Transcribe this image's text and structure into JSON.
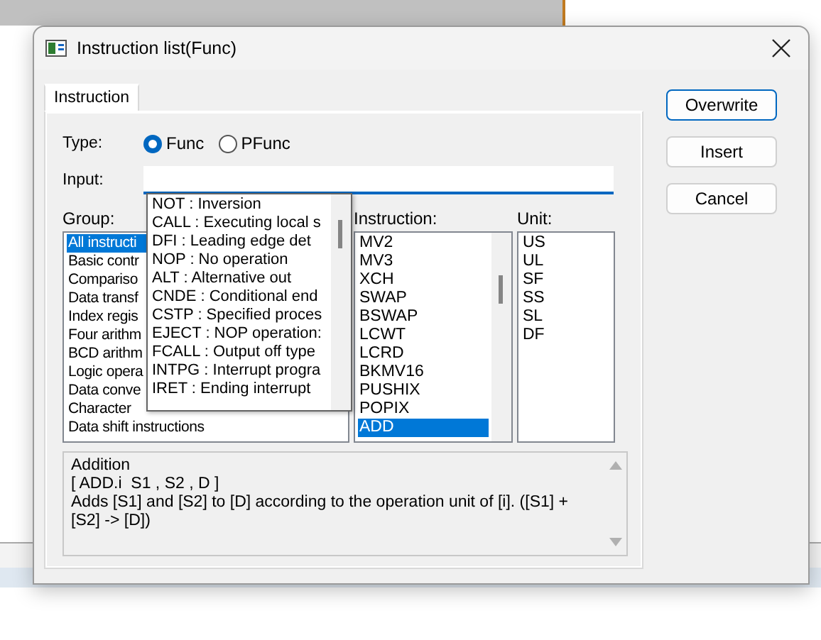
{
  "dialog": {
    "title": "Instruction list(Func)"
  },
  "tabs": [
    {
      "label": "Instruction",
      "selected": true
    }
  ],
  "type": {
    "label": "Type:",
    "options": [
      {
        "label": "Func",
        "selected": true
      },
      {
        "label": "PFunc",
        "selected": false
      }
    ]
  },
  "input": {
    "label": "Input:"
  },
  "dropdown": {
    "items": [
      {
        "text": "NOT : Inversion",
        "selected": false
      },
      {
        "text": "CALL : Executing local s",
        "selected": false
      },
      {
        "text": "DFI : Leading edge det",
        "selected": false
      },
      {
        "text": "NOP : No operation",
        "selected": false
      },
      {
        "text": "ALT : Alternative out",
        "selected": false
      },
      {
        "text": "CNDE : Conditional end",
        "selected": false
      },
      {
        "text": "CSTP : Specified proces",
        "selected": false
      },
      {
        "text": "EJECT : NOP operation:",
        "selected": false
      },
      {
        "text": "FCALL : Output off type",
        "selected": false
      },
      {
        "text": "INTPG : Interrupt progra",
        "selected": false
      },
      {
        "text": "IRET : Ending interrupt",
        "selected": false
      }
    ]
  },
  "group": {
    "label": "Group:",
    "items": [
      {
        "text": "All instructi",
        "selected": true
      },
      {
        "text": "Basic contr",
        "selected": false
      },
      {
        "text": "Compariso",
        "selected": false
      },
      {
        "text": "Data transf",
        "selected": false
      },
      {
        "text": "Index regis",
        "selected": false
      },
      {
        "text": "Four arithm",
        "selected": false
      },
      {
        "text": "BCD arithm",
        "selected": false
      },
      {
        "text": "Logic opera",
        "selected": false
      },
      {
        "text": "Data conve",
        "selected": false
      },
      {
        "text": "Character",
        "selected": false
      },
      {
        "text": "Data shift instructions",
        "selected": false
      }
    ]
  },
  "instruction": {
    "label": "Instruction:",
    "items": [
      {
        "text": "MV2",
        "selected": false
      },
      {
        "text": "MV3",
        "selected": false
      },
      {
        "text": "XCH",
        "selected": false
      },
      {
        "text": "SWAP",
        "selected": false
      },
      {
        "text": "BSWAP",
        "selected": false
      },
      {
        "text": "LCWT",
        "selected": false
      },
      {
        "text": "LCRD",
        "selected": false
      },
      {
        "text": "BKMV16",
        "selected": false
      },
      {
        "text": "PUSHIX",
        "selected": false
      },
      {
        "text": "POPIX",
        "selected": false
      },
      {
        "text": "ADD",
        "selected": true
      }
    ]
  },
  "unit": {
    "label": "Unit:",
    "items": [
      {
        "text": "US",
        "selected": false
      },
      {
        "text": "UL",
        "selected": false
      },
      {
        "text": "SF",
        "selected": false
      },
      {
        "text": "SS",
        "selected": false
      },
      {
        "text": "SL",
        "selected": false
      },
      {
        "text": "DF",
        "selected": false
      }
    ]
  },
  "description": {
    "lines": [
      "Addition",
      "[ ADD.i  S1 , S2 , D ]",
      "Adds [S1] and [S2] to [D] according to the operation unit of [i]. ([S1] + [S2] -> [D])"
    ]
  },
  "buttons": [
    {
      "label": "Overwrite",
      "default": true
    },
    {
      "label": "Insert",
      "default": false
    },
    {
      "label": "Cancel",
      "default": false
    }
  ]
}
